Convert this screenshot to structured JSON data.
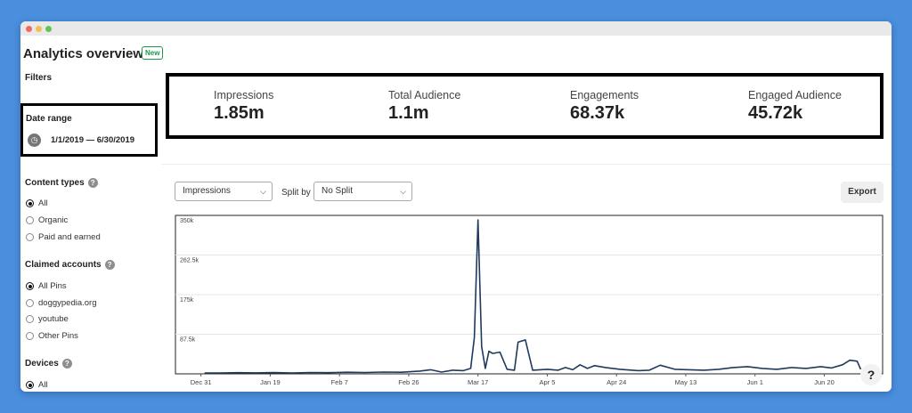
{
  "header": {
    "title": "Analytics overview",
    "badge": "New"
  },
  "sidebar": {
    "filters_label": "Filters",
    "date_range": {
      "label": "Date range",
      "value": "1/1/2019 — 6/30/2019",
      "icon": "clock-icon"
    },
    "content_types": {
      "label": "Content types",
      "options": [
        {
          "label": "All",
          "checked": true
        },
        {
          "label": "Organic",
          "checked": false
        },
        {
          "label": "Paid and earned",
          "checked": false
        }
      ]
    },
    "claimed_accounts": {
      "label": "Claimed accounts",
      "options": [
        {
          "label": "All Pins",
          "checked": true
        },
        {
          "label": "doggypedia.org",
          "checked": false
        },
        {
          "label": "youtube",
          "checked": false
        },
        {
          "label": "Other Pins",
          "checked": false
        }
      ]
    },
    "devices": {
      "label": "Devices",
      "options": [
        {
          "label": "All",
          "checked": true
        }
      ]
    }
  },
  "metrics": [
    {
      "label": "Impressions",
      "value": "1.85m"
    },
    {
      "label": "Total Audience",
      "value": "1.1m"
    },
    {
      "label": "Engagements",
      "value": "68.37k"
    },
    {
      "label": "Engaged Audience",
      "value": "45.72k"
    }
  ],
  "controls": {
    "metric_select": "Impressions",
    "split_label": "Split by",
    "split_select": "No Split",
    "export_label": "Export"
  },
  "help_label": "?",
  "chart_data": {
    "type": "line",
    "y_tick_labels": [
      "350k",
      "262.5k",
      "175k",
      "87.5k"
    ],
    "ylim": [
      0,
      350000
    ],
    "x_tick_labels": [
      "Dec 31",
      "Jan 19",
      "Feb 7",
      "Feb 26",
      "Mar 17",
      "Apr 5",
      "Apr 24",
      "May 13",
      "Jun 1",
      "Jun 20"
    ],
    "grid": true,
    "line_color": "#1f3a5c",
    "series": [
      {
        "x": [
          "Jan 1",
          "Jan 5",
          "Jan 10",
          "Jan 15",
          "Jan 20",
          "Jan 25",
          "Jan 30",
          "Feb 4",
          "Feb 9",
          "Feb 14",
          "Feb 19",
          "Feb 24",
          "Mar 1",
          "Mar 4",
          "Mar 7",
          "Mar 10",
          "Mar 13",
          "Mar 15",
          "Mar 16",
          "Mar 17",
          "Mar 18",
          "Mar 19",
          "Mar 20",
          "Mar 21",
          "Mar 23",
          "Mar 25",
          "Mar 27",
          "Mar 28",
          "Mar 30",
          "Apr 1",
          "Apr 3",
          "Apr 5",
          "Apr 8",
          "Apr 10",
          "Apr 12",
          "Apr 14",
          "Apr 16",
          "Apr 18",
          "Apr 21",
          "Apr 25",
          "Apr 30",
          "May 3",
          "May 6",
          "May 10",
          "May 14",
          "May 18",
          "May 22",
          "May 26",
          "May 30",
          "Jun 3",
          "Jun 7",
          "Jun 11",
          "Jun 15",
          "Jun 19",
          "Jun 22",
          "Jun 25",
          "Jun 27",
          "Jun 29",
          "Jun 30"
        ],
        "values": [
          2000,
          2000,
          2500,
          2200,
          2800,
          2000,
          3000,
          2500,
          3500,
          3000,
          4000,
          3500,
          6000,
          9000,
          4000,
          8000,
          7000,
          12000,
          80000,
          340000,
          60000,
          12000,
          50000,
          45000,
          48000,
          10000,
          8000,
          70000,
          75000,
          8000,
          9000,
          10000,
          8000,
          14000,
          9000,
          20000,
          12000,
          18000,
          14000,
          10000,
          7000,
          8000,
          19000,
          10000,
          9000,
          8000,
          10000,
          14000,
          16000,
          12000,
          10000,
          14000,
          12000,
          16000,
          13000,
          20000,
          30000,
          28000,
          10000
        ]
      }
    ]
  }
}
